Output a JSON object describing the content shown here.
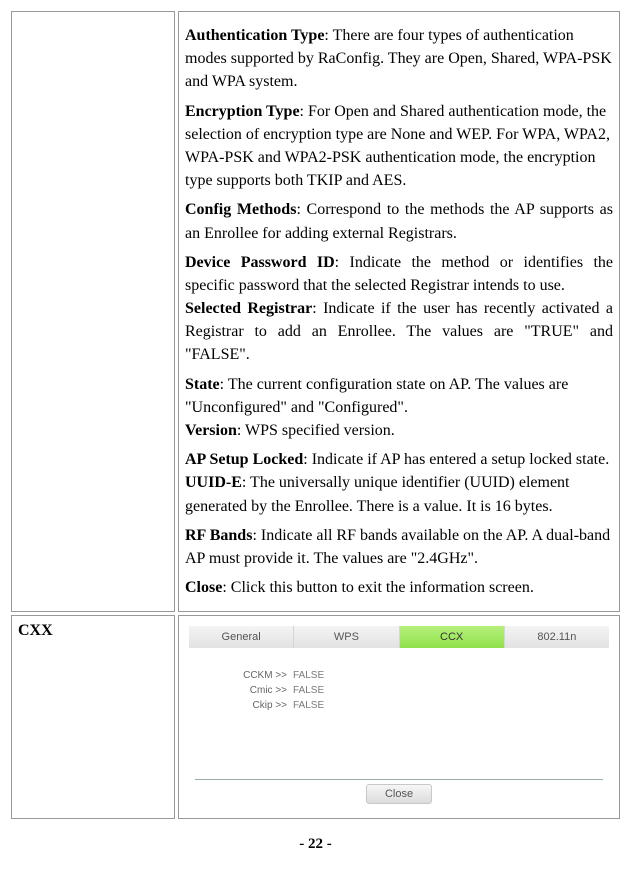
{
  "page_number": "- 22 -",
  "row1": {
    "left": "",
    "items": [
      {
        "label": "Authentication Type",
        "text": ": There are four types of authentication modes supported by RaConfig. They are Open, Shared, WPA-PSK and WPA system.",
        "justify": false
      },
      {
        "label": "Encryption Type",
        "text": ": For Open and Shared authentication mode, the selection of encryption type are None and WEP. For WPA, WPA2, WPA-PSK and WPA2-PSK authentication mode, the encryption type supports both TKIP and AES.",
        "justify": false
      },
      {
        "label": "Config Methods",
        "text": ": Correspond to the methods the AP supports as an Enrollee for adding external Registrars.",
        "justify": true
      },
      {
        "label": "Device Password ID",
        "text": ": Indicate the method or identifies the specific password that the selected Registrar intends to use.",
        "justify": true,
        "append": {
          "label": "Selected Registrar",
          "text": ": Indicate if the user has recently activated a Registrar to add an Enrollee. The values are \"TRUE\" and \"FALSE\"."
        }
      },
      {
        "label": "State",
        "text": ": The current configuration state on AP. The values are \"Unconfigured\" and \"Configured\".",
        "justify": false,
        "append": {
          "label": "Version",
          "text": ": WPS specified version."
        }
      },
      {
        "label": "AP Setup Locked",
        "text": ": Indicate if AP has entered a setup locked state.",
        "justify": false,
        "append": {
          "label": "UUID-E",
          "text": ": The universally unique identifier (UUID) element generated by the Enrollee. There is a value. It is 16 bytes."
        }
      },
      {
        "label": "RF Bands",
        "text": ": Indicate all RF bands available on the AP. A dual-band AP must provide it. The values are \"2.4GHz\".",
        "justify": false
      },
      {
        "label": "Close",
        "text": ": Click this button to exit the information screen.",
        "justify": false
      }
    ]
  },
  "row2": {
    "left": "CXX",
    "tabs": [
      {
        "label": "General",
        "active": false
      },
      {
        "label": "WPS",
        "active": false
      },
      {
        "label": "CCX",
        "active": true
      },
      {
        "label": "802.11n",
        "active": false
      }
    ],
    "rows": [
      {
        "key": "CCKM >>",
        "val": "FALSE"
      },
      {
        "key": "Cmic >>",
        "val": "FALSE"
      },
      {
        "key": "Ckip >>",
        "val": "FALSE"
      }
    ],
    "close_label": "Close"
  }
}
